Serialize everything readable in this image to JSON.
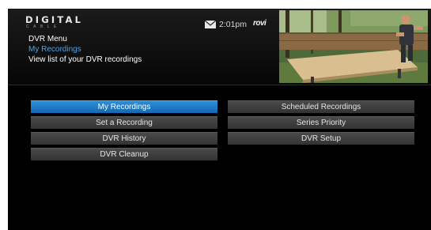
{
  "logo": {
    "main": "DIGITAL",
    "sub": "CABLE"
  },
  "header": {
    "menu_title": "DVR Menu",
    "selected_item": "My Recordings",
    "description": "View list of your DVR recordings",
    "time": "2:01pm",
    "brand": "rovi",
    "mail_icon": "envelope-icon"
  },
  "menu": {
    "left": [
      {
        "label": "My Recordings",
        "selected": true
      },
      {
        "label": "Set a Recording",
        "selected": false
      },
      {
        "label": "DVR History",
        "selected": false
      },
      {
        "label": "DVR Cleanup",
        "selected": false
      }
    ],
    "right": [
      {
        "label": "Scheduled Recordings",
        "selected": false
      },
      {
        "label": "Series Priority",
        "selected": false
      },
      {
        "label": "DVR Setup",
        "selected": false
      }
    ]
  },
  "colors": {
    "accent": "#1e7ccc",
    "button": "#3c3c3c",
    "background": "#000000",
    "highlight_text": "#4aa3e8"
  }
}
